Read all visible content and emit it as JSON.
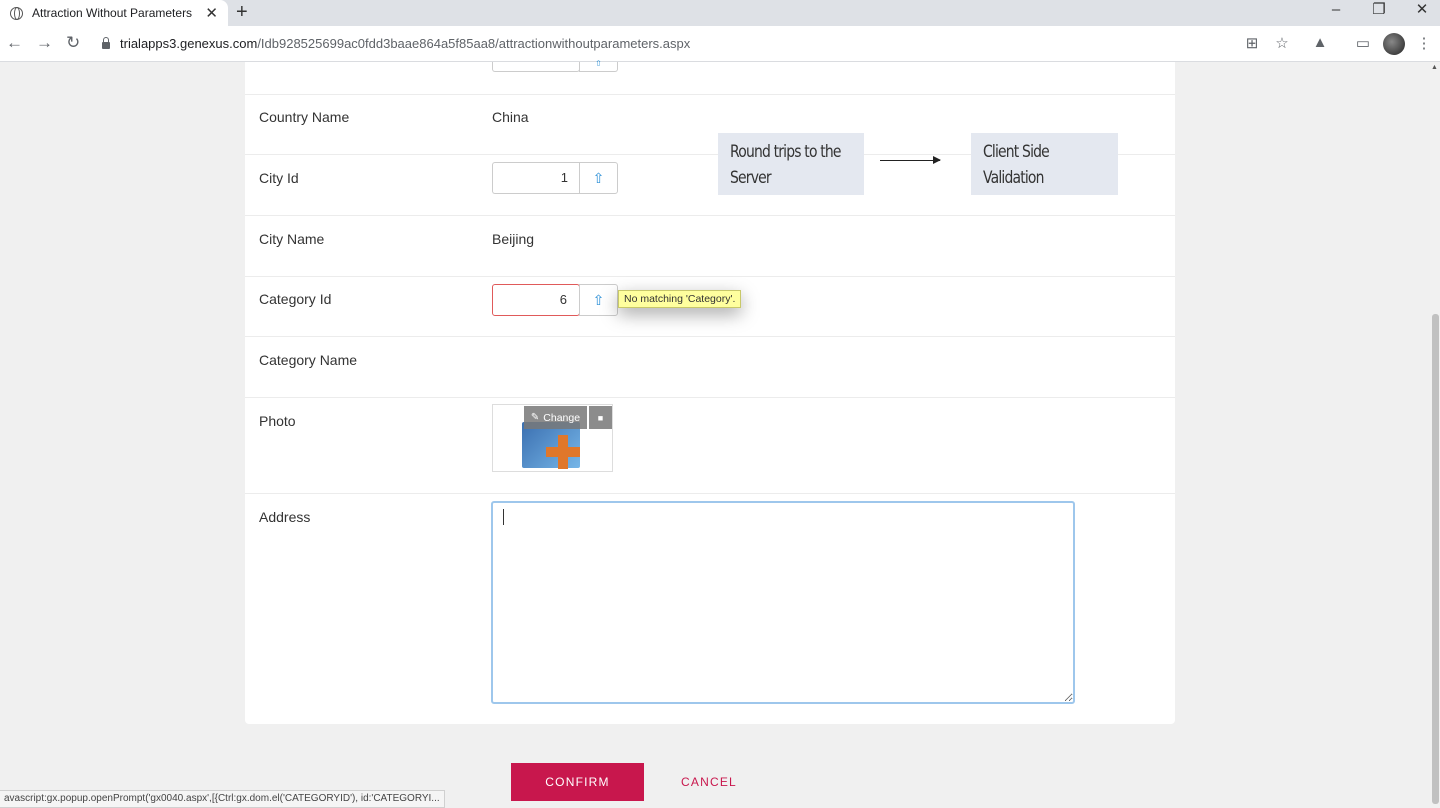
{
  "browser": {
    "tab_title": "Attraction Without Parameters",
    "tab_close": "✕",
    "new_tab": "+",
    "url_host": "trialapps3.genexus.com",
    "url_path": "/Idb928525699ac0fdd3baae864a5f85aa8/attractionwithoutparameters.aspx",
    "window_controls": [
      "–",
      "❐",
      "✕"
    ]
  },
  "form": {
    "rows": [
      {
        "label": "Country Name",
        "value": "China"
      },
      {
        "label": "City Id",
        "value": "1"
      },
      {
        "label": "City Name",
        "value": "Beijing"
      },
      {
        "label": "Category Id",
        "value": "6"
      },
      {
        "label": "Category Name",
        "value": ""
      },
      {
        "label": "Photo",
        "value": ""
      },
      {
        "label": "Address",
        "value": ""
      }
    ],
    "photo": {
      "change_label": "Change"
    },
    "error_tooltip": "No matching 'Category'.",
    "confirm_label": "CONFIRM",
    "cancel_label": "CANCEL"
  },
  "annotations": {
    "left_callout": [
      "Round trips to the",
      "Server"
    ],
    "right_callout": [
      "Client Side",
      "Validation"
    ]
  },
  "status_bar": "avascript:gx.popup.openPrompt('gx0040.aspx',[{Ctrl:gx.dom.el('CATEGORYID'), id:'CATEGORYI...",
  "colors": {
    "accent": "#c8174d",
    "prompt_icon": "#2b8fd6",
    "error_border": "#e05a5a",
    "tooltip_bg": "#ffff9e"
  }
}
